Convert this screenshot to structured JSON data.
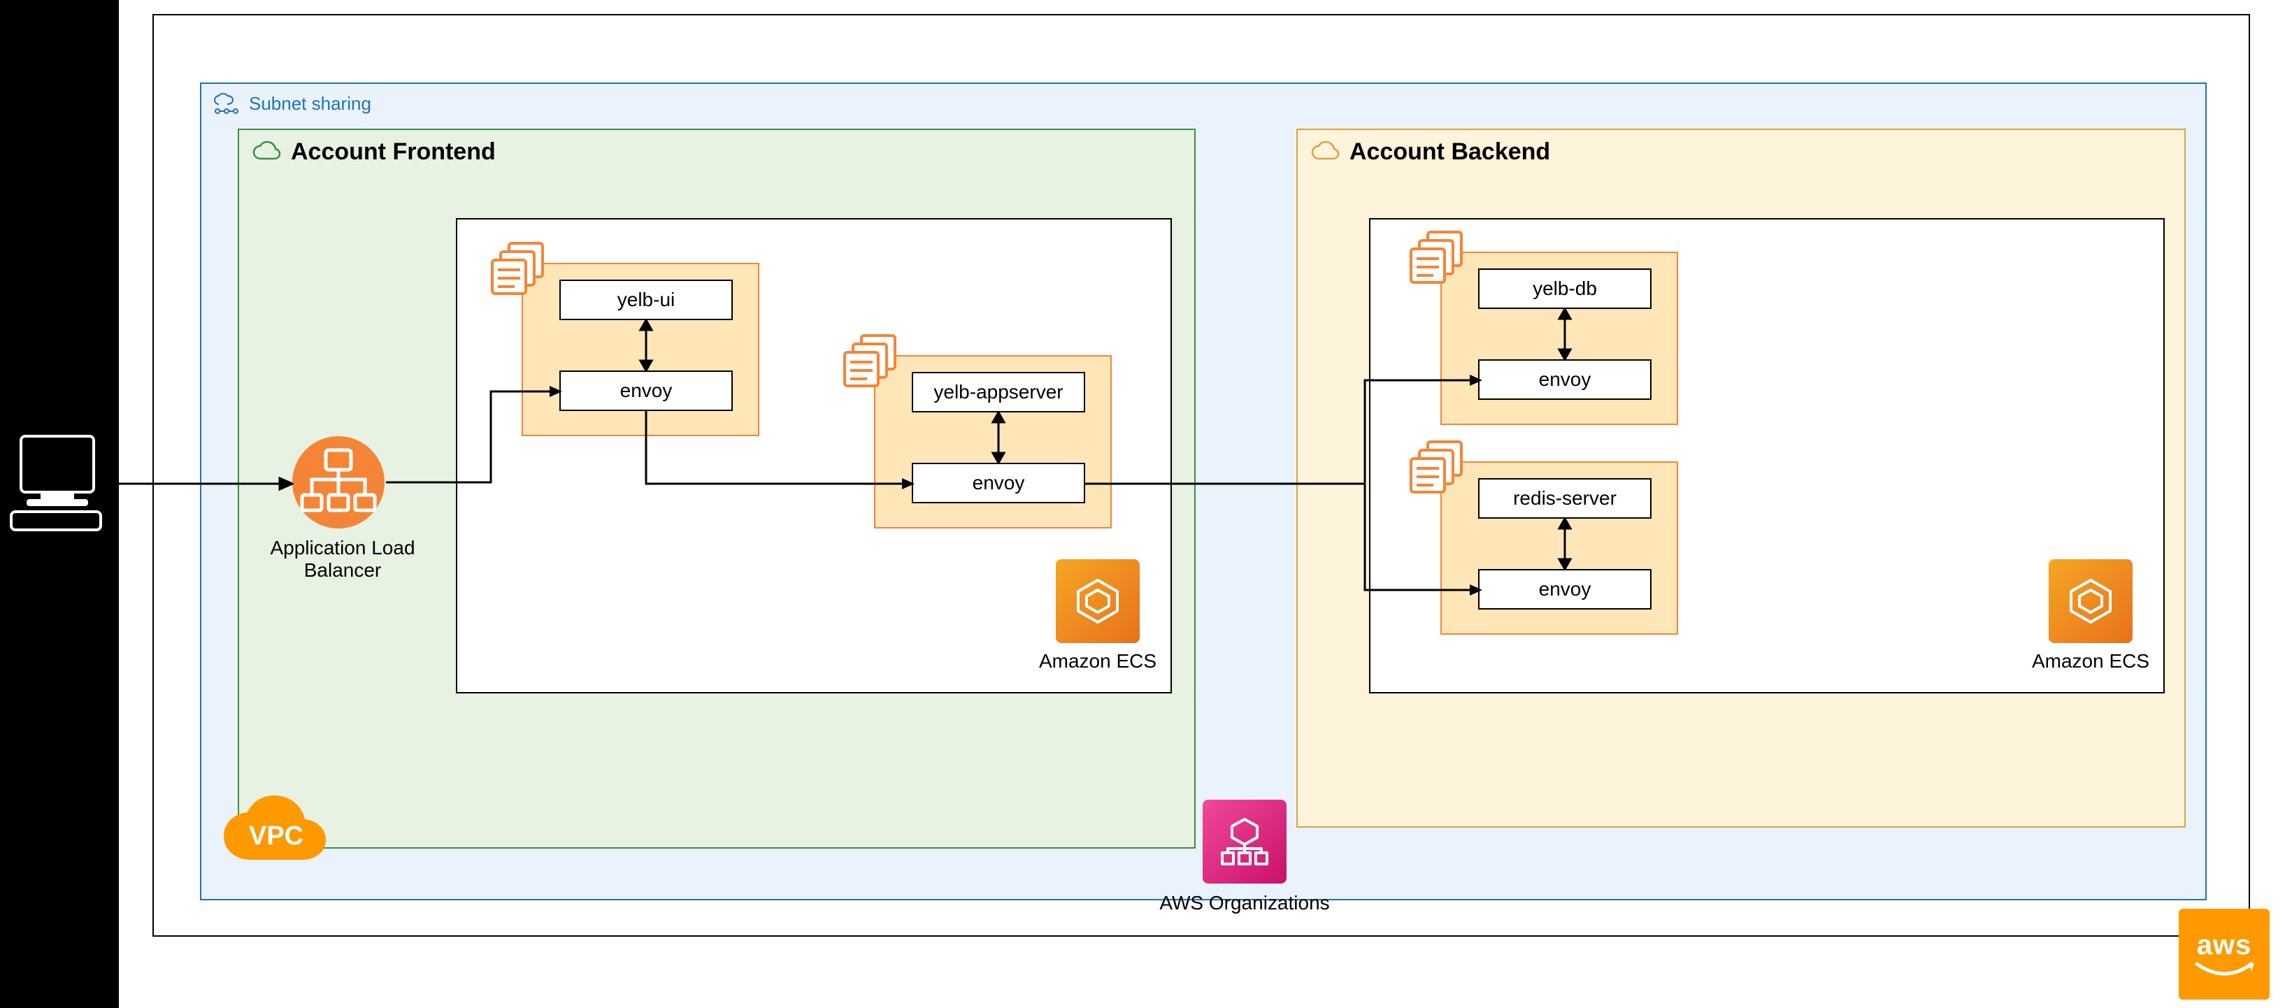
{
  "outer_vpc_label": "",
  "subnet_box": {
    "label": "Subnet sharing"
  },
  "client": {
    "label": ""
  },
  "alb": {
    "label": "Application Load Balancer"
  },
  "vpc_badge": "VPC",
  "frontend": {
    "title": "Account Frontend",
    "ecs_label": "Amazon ECS",
    "task1": {
      "a": "yelb-ui",
      "b": "envoy"
    },
    "task2": {
      "a": "yelb-appserver",
      "b": "envoy"
    }
  },
  "backend": {
    "title": "Account Backend",
    "ecs_label": "Amazon ECS",
    "task1": {
      "a": "yelb-db",
      "b": "envoy"
    },
    "task2": {
      "a": "redis-server",
      "b": "envoy"
    }
  },
  "orgs_label": "AWS Organizations",
  "aws_logo": "aws",
  "colors": {
    "subnet_border": "#1E73B8",
    "subnet_fill": "#EAF3FB",
    "frontend_border": "#3B8F3E",
    "frontend_fill": "#E7F2E3",
    "backend_border": "#D9A441",
    "backend_fill": "#FEF3DB",
    "orange": "#FF9900",
    "magenta": "#E7157B"
  }
}
